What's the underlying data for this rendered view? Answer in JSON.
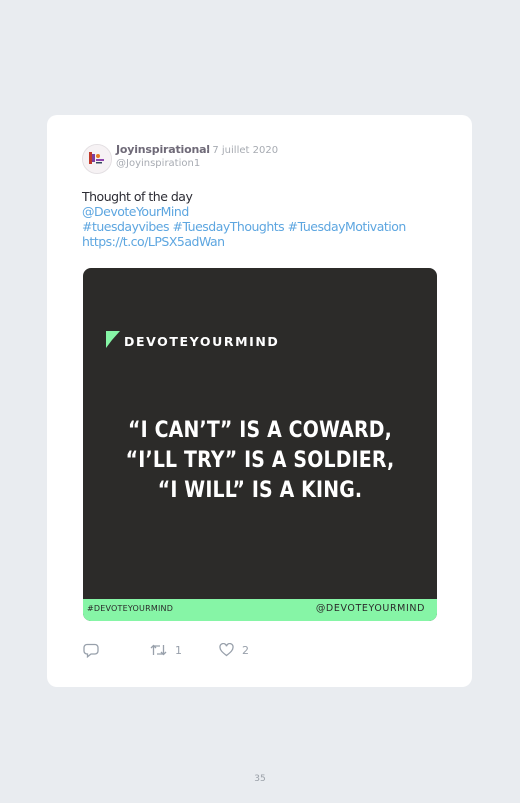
{
  "tweet": {
    "author_name": "Joyinspirational",
    "date": "· 7 juillet 2020",
    "handle": "@Joyinspiration1",
    "text_line1": "Thought of the day",
    "mention": "@DevoteYourMind",
    "hashtags": "#tuesdayvibes #TuesdayThoughts #TuesdayMotivation",
    "link": "https://t.co/LPSX5adWan"
  },
  "media": {
    "brand": "DEVOTEYOURMIND",
    "quote_line1": "“I CAN’T” IS A COWARD,",
    "quote_line2": "“I’LL TRY” IS A SOLDIER,",
    "quote_line3": "“I WILL” IS A KING.",
    "footer_left": "#DEVOTEYOURMIND",
    "footer_right": "@DEVOTEYOURMIND",
    "background_color": "#2c2b29",
    "accent_color": "#86f5a6"
  },
  "actions": {
    "reply_icon": "reply-icon",
    "retweet_icon": "retweet-icon",
    "like_icon": "heart-icon",
    "retweet_count": "1",
    "like_count": "2"
  },
  "page": {
    "number": "35"
  },
  "colors": {
    "link": "#5da6e0",
    "background": "#e9ecf0"
  }
}
